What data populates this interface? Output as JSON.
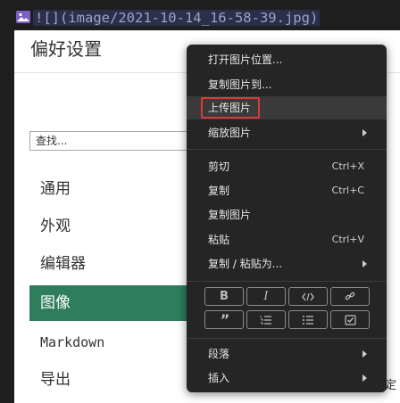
{
  "editor": {
    "image_markdown": "![](image/2021-10-14_16-58-39.jpg)"
  },
  "preferences": {
    "title": "偏好设置",
    "search_placeholder": "查找...",
    "nav": [
      {
        "label": "通用"
      },
      {
        "label": "外观"
      },
      {
        "label": "编辑器"
      },
      {
        "label": "图像",
        "active": true
      },
      {
        "label": "Markdown"
      },
      {
        "label": "导出"
      }
    ],
    "stray_text_1": "、",
    "stray_text_2": "定"
  },
  "context_menu": {
    "items": [
      {
        "label": "打开图片位置..."
      },
      {
        "label": "复制图片到..."
      },
      {
        "label": "上传图片",
        "highlighted": true
      },
      {
        "label": "缩放图片",
        "submenu": true
      },
      {
        "label": "剪切",
        "shortcut": "Ctrl+X"
      },
      {
        "label": "复制",
        "shortcut": "Ctrl+C"
      },
      {
        "label": "复制图片"
      },
      {
        "label": "粘贴",
        "shortcut": "Ctrl+V"
      },
      {
        "label": "复制 / 粘贴为...",
        "submenu": true
      },
      {
        "label": "段落",
        "submenu": true
      },
      {
        "label": "插入",
        "submenu": true
      }
    ],
    "format_buttons": {
      "bold": "B",
      "italic": "I",
      "quote": "”"
    },
    "colors": {
      "highlight_border": "#d93a3a",
      "menu_bg": "#252525",
      "active_nav": "#2e7d5b"
    },
    "icons": [
      "bold-icon",
      "italic-icon",
      "code-icon",
      "link-icon",
      "quote-icon",
      "ordered-list-icon",
      "unordered-list-icon",
      "task-list-icon"
    ]
  }
}
